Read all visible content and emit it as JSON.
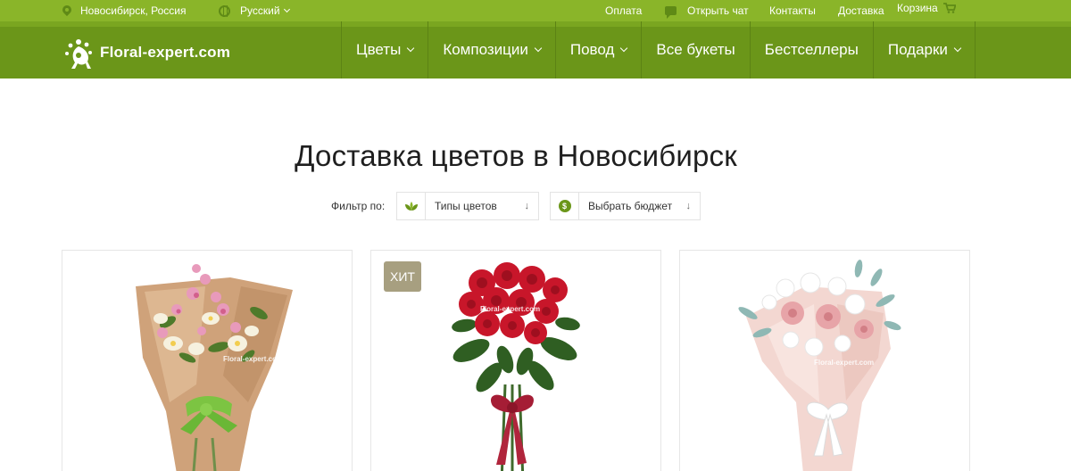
{
  "topbar": {
    "city": "Новосибирск, Россия",
    "language": "Русский",
    "links": {
      "payment": "Оплата",
      "chat": "Открыть чат",
      "contacts": "Контакты",
      "delivery": "Доставка",
      "cart": "Корзина"
    }
  },
  "header": {
    "logo_text": "Floral-expert.com",
    "nav": {
      "flowers": "Цветы",
      "compositions": "Композиции",
      "occasion": "Повод",
      "all_bouquets": "Все букеты",
      "bestsellers": "Бестселлеры",
      "gifts": "Подарки"
    }
  },
  "main": {
    "title": "Доставка цветов в Новосибирск",
    "filter": {
      "label": "Фильтр по:",
      "flower_types": "Типы цветов",
      "budget": "Выбрать бюджет",
      "arrow": "↓",
      "budget_icon": "$"
    },
    "products": [
      {
        "badge": "",
        "watermark": "Floral-expert.com"
      },
      {
        "badge": "ХИТ",
        "watermark": "Floral-expert.com"
      },
      {
        "badge": "",
        "watermark": "Floral-expert.com"
      }
    ]
  },
  "colors": {
    "topbar_bg": "#8ab529",
    "navbar_bg": "#6b9619",
    "badge_bg": "#a79f80",
    "icon_dark_green": "#5f8a16"
  },
  "icons": [
    "location-pin-icon",
    "globe-icon",
    "chevron-down-icon",
    "chat-icon",
    "cart-icon",
    "leaf-icon",
    "dollar-coin-icon",
    "arrow-down-icon"
  ]
}
